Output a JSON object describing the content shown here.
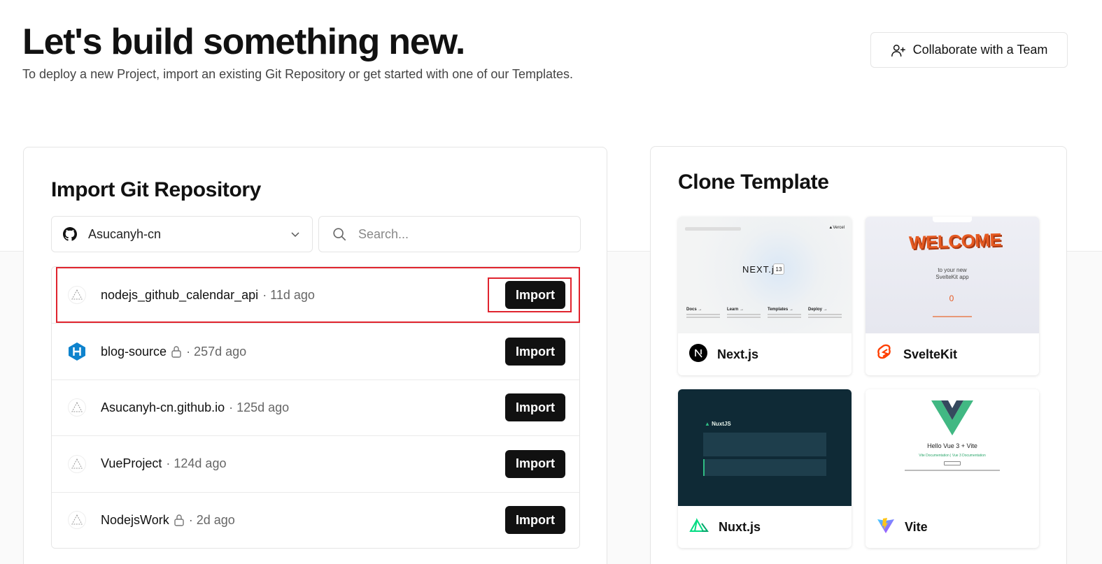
{
  "hero": {
    "title": "Let's build something new.",
    "subtitle": "To deploy a new Project, import an existing Git Repository or get started with one of our Templates.",
    "collab_label": "Collaborate with a Team"
  },
  "import": {
    "title": "Import Git Repository",
    "account": "Asucanyh-cn",
    "search_placeholder": "Search...",
    "import_label": "Import",
    "repos": [
      {
        "name": "nodejs_github_calendar_api",
        "time": "· 11d ago",
        "private": false,
        "icon": "vercel-triangle-icon"
      },
      {
        "name": "blog-source",
        "time": "· 257d ago",
        "private": true,
        "icon": "hexo-h-icon"
      },
      {
        "name": "Asucanyh-cn.github.io",
        "time": "· 125d ago",
        "private": false,
        "icon": "vercel-triangle-icon"
      },
      {
        "name": "VueProject",
        "time": "· 124d ago",
        "private": false,
        "icon": "vercel-triangle-icon"
      },
      {
        "name": "NodejsWork",
        "time": "· 2d ago",
        "private": true,
        "icon": "vercel-triangle-icon"
      }
    ]
  },
  "templates": {
    "title": "Clone Template",
    "items": [
      {
        "name": "Next.js",
        "icon": "nextjs-icon"
      },
      {
        "name": "SvelteKit",
        "icon": "svelte-icon"
      },
      {
        "name": "Nuxt.js",
        "icon": "nuxt-icon"
      },
      {
        "name": "Vite",
        "icon": "vite-icon"
      }
    ],
    "next_thumb": {
      "brand": "NEXT.js",
      "version": "13",
      "vercel": "▲Vercel",
      "cols": [
        "Docs →",
        "Learn →",
        "Templates →",
        "Deploy →"
      ]
    },
    "svelte_thumb": {
      "welcome": "WELCOME",
      "sub1": "to your new",
      "sub2": "SvelteKit app",
      "count": "0"
    },
    "nuxt_thumb": {
      "logo": "NuxtJS"
    },
    "vite_thumb": {
      "hello": "Hello Vue 3 + Vite",
      "links": "Vite Documentation | Vue 3 Documentation"
    }
  },
  "colors": {
    "accent": "#111111",
    "highlight": "#e0242e",
    "hexo_blue": "#0e83cd",
    "svelte_orange": "#ff3e00",
    "nuxt_green": "#00dc82"
  }
}
